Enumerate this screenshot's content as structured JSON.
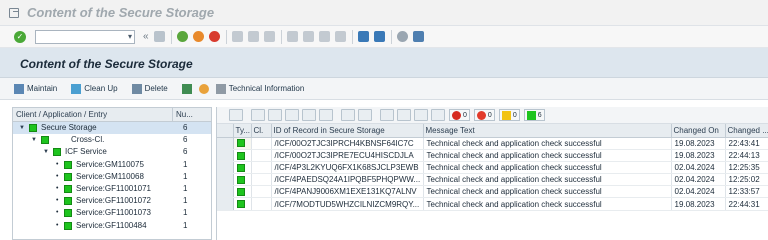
{
  "window": {
    "title": "Content of the Secure Storage"
  },
  "toolbar": {
    "back_arrows": "«"
  },
  "page": {
    "title": "Content of the Secure Storage"
  },
  "app_toolbar": {
    "maintain": "Maintain",
    "clean_up": "Clean Up",
    "delete": "Delete",
    "technical_information": "Technical Information"
  },
  "tree": {
    "col_entry": "Client / Application / Entry",
    "col_num": "Nu...",
    "rows": [
      {
        "label": "Secure Storage",
        "num": "6"
      },
      {
        "label": "Cross-Cl.",
        "num": "6"
      },
      {
        "label": "ICF Service",
        "num": "6"
      },
      {
        "label": "Service:GM110075",
        "num": "1"
      },
      {
        "label": "Service:GM110068",
        "num": "1"
      },
      {
        "label": "Service:GF11001071",
        "num": "1"
      },
      {
        "label": "Service:GF11001072",
        "num": "1"
      },
      {
        "label": "Service:GF11001073",
        "num": "1"
      },
      {
        "label": "Service:GF1100484",
        "num": "1"
      }
    ]
  },
  "counts": {
    "red": "0",
    "error": "0",
    "warning": "0",
    "success": "6"
  },
  "grid": {
    "headers": {
      "type": "Ty...",
      "cl": "Cl.",
      "id": "ID of Record in Secure Storage",
      "msg": "Message Text",
      "changed_on": "Changed On",
      "changed_at": "Changed ..."
    },
    "rows": [
      {
        "id": "/ICF/00O2TJC3IPRCH4KBNSF64IC7C",
        "msg": "Technical check and application check successful",
        "on": "19.08.2023",
        "at": "22:43:41"
      },
      {
        "id": "/ICF/00O2TJC3IPRE7ECU4HISCDJLA",
        "msg": "Technical check and application check successful",
        "on": "19.08.2023",
        "at": "22:44:13"
      },
      {
        "id": "/ICF/4P3L2KYUQ6FX1K68SJCLP3EWB",
        "msg": "Technical check and application check successful",
        "on": "02.04.2024",
        "at": "12:25:35"
      },
      {
        "id": "/ICF/4PAEDSQ24A1IPQBF5PHQPWW...",
        "msg": "Technical check and application check successful",
        "on": "02.04.2024",
        "at": "12:25:02"
      },
      {
        "id": "/ICF/4PANJ9006XM1EXE131KQ7ALNV",
        "msg": "Technical check and application check successful",
        "on": "02.04.2024",
        "at": "12:33:57"
      },
      {
        "id": "/ICF/7MODTUD5WHZCILNIZCM9RQY...",
        "msg": "Technical check and application check successful",
        "on": "19.08.2023",
        "at": "22:44:31"
      }
    ]
  },
  "colors": {
    "success": "#1ec41e",
    "header_bg": "#dde6ee"
  }
}
